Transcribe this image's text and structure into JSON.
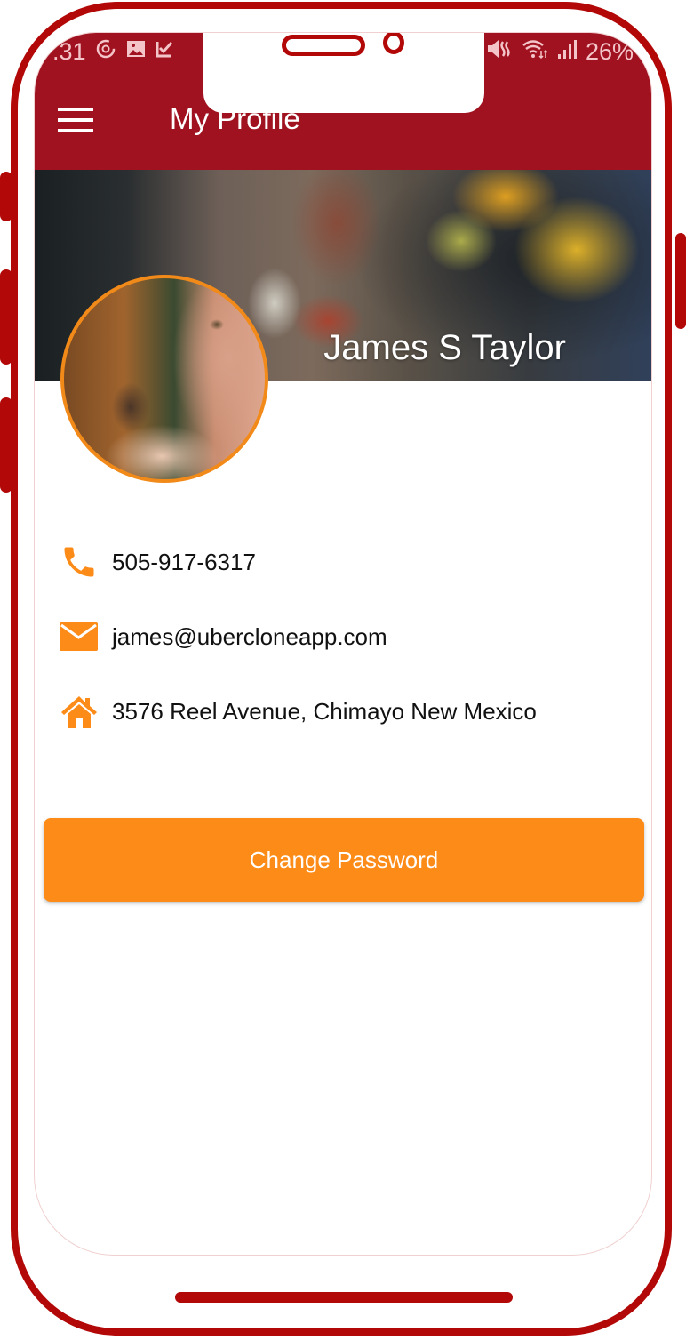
{
  "status_bar": {
    "time": ".31",
    "battery": "26%",
    "left_icons": [
      "sync-icon",
      "image-icon",
      "checkbox-icon"
    ],
    "right_icons": [
      "mute-icon",
      "wifi-icon",
      "signal-icon"
    ]
  },
  "app_bar": {
    "title": "My Profile",
    "menu_icon": "hamburger-menu-icon"
  },
  "profile": {
    "name": "James S Taylor",
    "phone": "505-917-6317",
    "email": "james@ubercloneapp.com",
    "address": "3576 Reel Avenue, Chimayo New Mexico"
  },
  "actions": {
    "change_password_label": "Change Password"
  },
  "colors": {
    "app_bar": "#a01220",
    "accent": "#fd8b17",
    "frame": "#b30808"
  }
}
